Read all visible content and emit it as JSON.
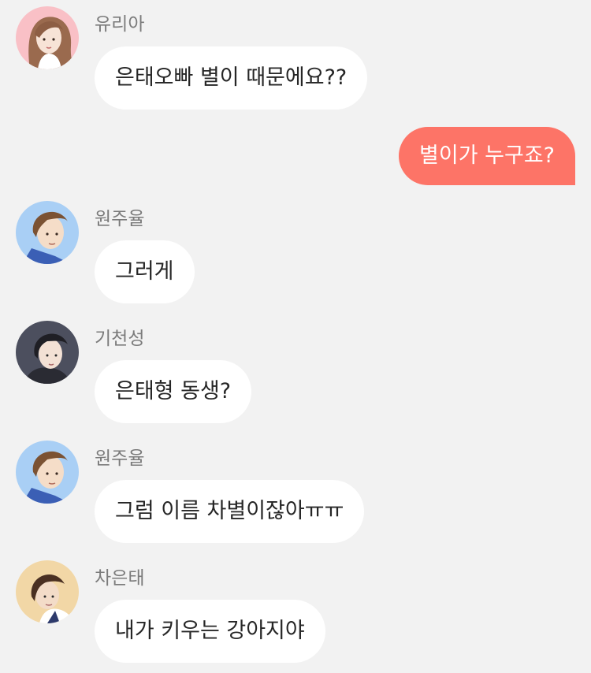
{
  "colors": {
    "background": "#f2f2f2",
    "incoming_bubble": "#ffffff",
    "outgoing_bubble": "#fd7467",
    "name_text": "#7b7b7b"
  },
  "messages": [
    {
      "sender": "유리아",
      "text": "은태오빠 별이 때문에요??",
      "avatar": "yuria-avatar"
    },
    {
      "sender": "me",
      "text": "별이가 누구죠?"
    },
    {
      "sender": "원주율",
      "text": "그러게",
      "avatar": "wonjuyul-avatar"
    },
    {
      "sender": "기천성",
      "text": "은태형 동생?",
      "avatar": "gicheonseong-avatar"
    },
    {
      "sender": "원주율",
      "text": "그럼 이름 차별이잖아ㅠㅠ",
      "avatar": "wonjuyul-avatar"
    },
    {
      "sender": "차은태",
      "text": "내가 키우는 강아지야",
      "avatar": "chaeuntae-avatar"
    }
  ]
}
